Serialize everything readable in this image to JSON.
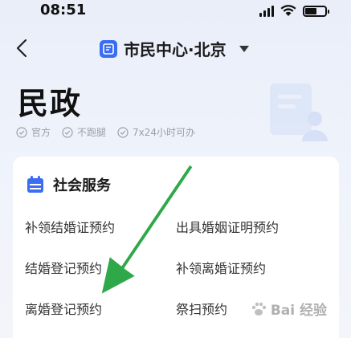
{
  "status_bar": {
    "time": "08:51"
  },
  "nav": {
    "title": "市民中心·北京"
  },
  "page": {
    "title": "民政",
    "tags": [
      "官方",
      "不跑腿",
      "7x24小时可办"
    ]
  },
  "section": {
    "title": "社会服务",
    "items": [
      "补领结婚证预约",
      "出具婚姻证明预约",
      "结婚登记预约",
      "补领离婚证预约",
      "离婚登记预约",
      "祭扫预约"
    ]
  },
  "watermark": {
    "text": "Bai 经验"
  },
  "colors": {
    "accent": "#3b6df2",
    "arrow": "#2fa84a",
    "tag_gray": "#9aa0aa"
  }
}
